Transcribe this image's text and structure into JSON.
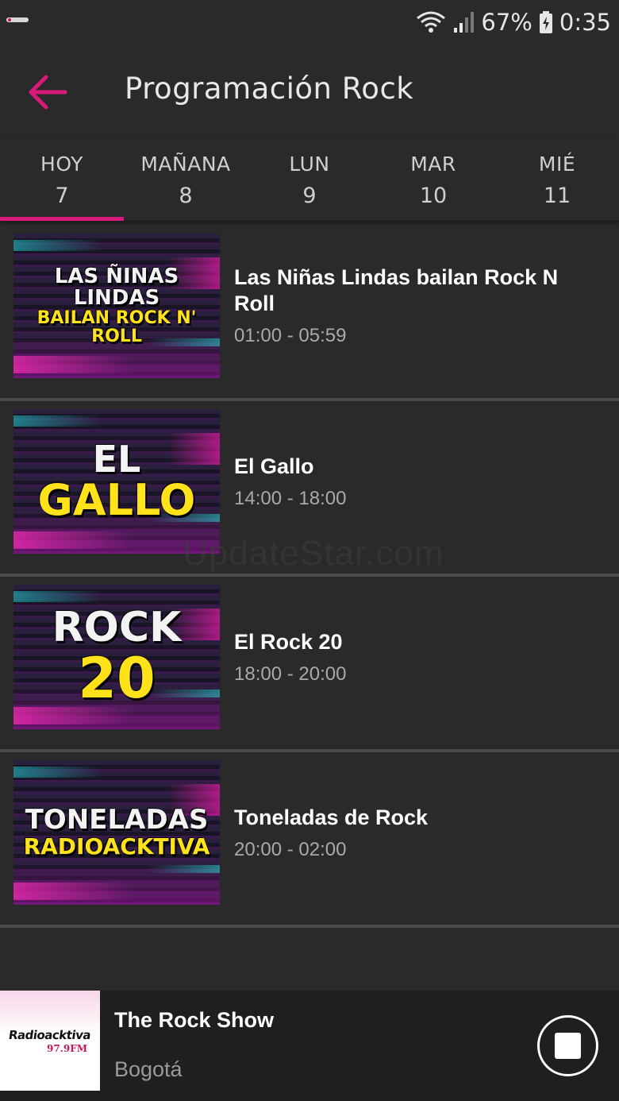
{
  "status_bar": {
    "battery": "67%",
    "time": "0:35",
    "icons": [
      "wifi-icon",
      "signal-icon",
      "battery-charging-icon"
    ]
  },
  "app_bar": {
    "title": "Programación Rock",
    "back_icon": "arrow-back-icon",
    "accent_color": "#d81b7a"
  },
  "tabs": [
    {
      "label": "HOY",
      "day": "7",
      "active": true
    },
    {
      "label": "MAÑANA",
      "day": "8",
      "active": false
    },
    {
      "label": "LUN",
      "day": "9",
      "active": false
    },
    {
      "label": "MAR",
      "day": "10",
      "active": false
    },
    {
      "label": "MIÉ",
      "day": "11",
      "active": false
    }
  ],
  "programs": [
    {
      "thumb_lines": [
        {
          "text": "LAS ÑINAS LINDAS"
        },
        {
          "text": "BAILAN ROCK N' ROLL"
        }
      ],
      "title": "Las Niñas Lindas bailan Rock N Roll",
      "time": "01:00 - 05:59"
    },
    {
      "thumb_lines": [
        {
          "text": "EL"
        },
        {
          "text": "GALLO"
        }
      ],
      "title": "El Gallo",
      "time": "14:00 - 18:00"
    },
    {
      "thumb_lines": [
        {
          "text": "ROCK"
        },
        {
          "text": "20"
        }
      ],
      "title": "El Rock 20",
      "time": "18:00 - 20:00"
    },
    {
      "thumb_lines": [
        {
          "text": "TONELADAS"
        },
        {
          "text": "RADIOACKTIVA"
        }
      ],
      "title": "Toneladas de Rock",
      "time": "20:00 - 02:00"
    }
  ],
  "watermark": "UpdateStar.com",
  "now_playing": {
    "logo_text": "Radioacktiva",
    "logo_freq": "97.9FM",
    "title": "The Rock Show",
    "subtitle": "Bogotá",
    "control_icon": "stop-icon"
  }
}
